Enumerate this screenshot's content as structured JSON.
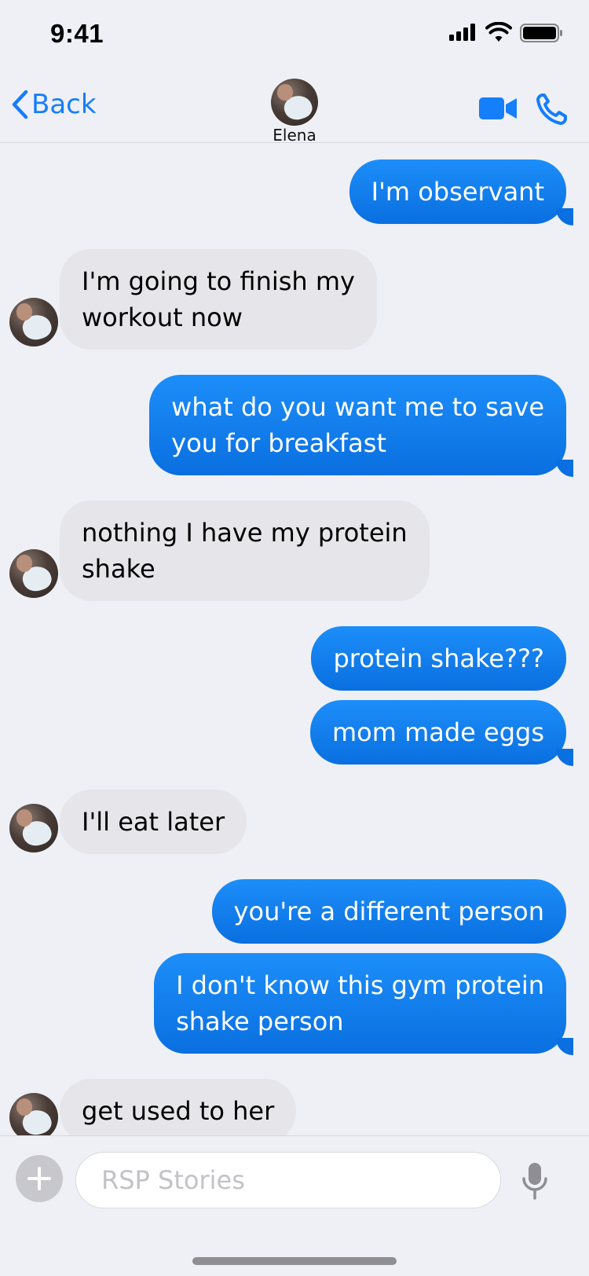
{
  "status_bar": {
    "time": "9:41"
  },
  "header": {
    "back_label": "Back",
    "contact_name": "Elena"
  },
  "colors": {
    "accent": "#157efb",
    "outgoing_bubble": "#0a6fe0",
    "incoming_bubble": "#e5e5ea",
    "background": "#eff0f5"
  },
  "messages": [
    {
      "direction": "out",
      "text": "I'm observant"
    },
    {
      "direction": "in",
      "text": "I'm going to finish my\nworkout now"
    },
    {
      "direction": "out",
      "text": "what do you want me to save\nyou for breakfast"
    },
    {
      "direction": "in",
      "text": "nothing I have my protein\nshake"
    },
    {
      "direction": "out",
      "text": "protein shake???"
    },
    {
      "direction": "out",
      "text": "mom made eggs"
    },
    {
      "direction": "in",
      "text": "I'll eat later"
    },
    {
      "direction": "out",
      "text": "you're a different person"
    },
    {
      "direction": "out",
      "text": "I don't know this gym protein\nshake person"
    },
    {
      "direction": "in",
      "text": "get used to her"
    }
  ],
  "composer": {
    "placeholder": "RSP Stories"
  }
}
